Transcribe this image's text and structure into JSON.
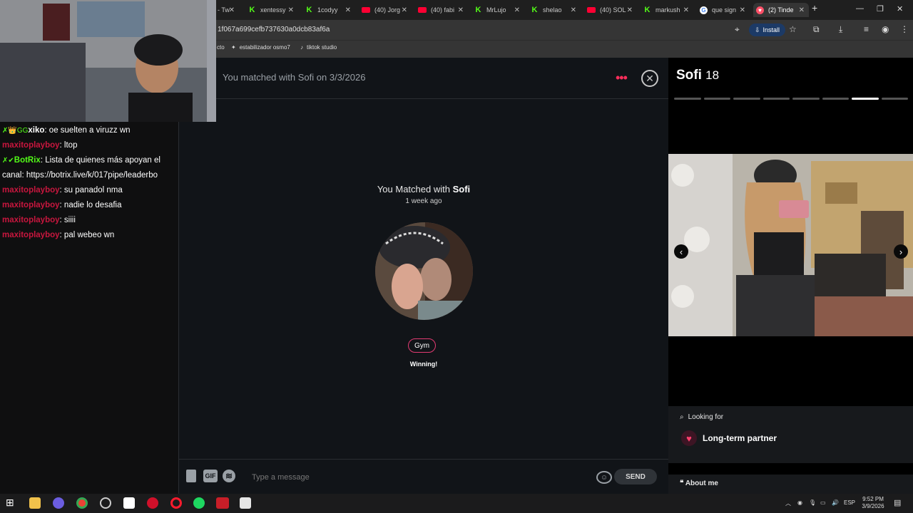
{
  "browser": {
    "tabs": [
      {
        "label": "- Tw",
        "favicon": "tab-fragment"
      },
      {
        "label": "xentessy",
        "favicon": "kick-icon"
      },
      {
        "label": "1codyy",
        "favicon": "kick-icon"
      },
      {
        "label": "(40) Jorg",
        "favicon": "youtube-icon"
      },
      {
        "label": "(40) fabi",
        "favicon": "youtube-icon"
      },
      {
        "label": "MrLujo",
        "favicon": "kick-icon"
      },
      {
        "label": "shelao",
        "favicon": "kick-icon"
      },
      {
        "label": "(40) SOL",
        "favicon": "youtube-icon"
      },
      {
        "label": "markush",
        "favicon": "kick-icon"
      },
      {
        "label": "que sign",
        "favicon": "google-icon"
      },
      {
        "label": "(2) Tinde",
        "favicon": "tinder-icon",
        "active": true
      }
    ],
    "url": "1f067a699cefb737630a0dcb83af6a",
    "install_label": "Install",
    "bookmarks": [
      "cto",
      "estabilizador osmo7",
      "tiktok studio"
    ]
  },
  "chat": {
    "header_title": "You matched with Sofi on 3/3/2026",
    "match_prefix": "You Matched with",
    "match_name": "Sofi",
    "match_time": "1 week ago",
    "chip_label": "Gym",
    "chip_sub": "Winning!",
    "gif_label": "GIF",
    "input_placeholder": "Type a message",
    "send_label": "SEND"
  },
  "profile": {
    "name": "Sofi",
    "age": "18",
    "photo_count": 8,
    "active_photo_index": 6,
    "looking_for_label": "Looking for",
    "looking_for_value": "Long-term partner",
    "about_label": "About me"
  },
  "stream_chat": [
    {
      "badges": "✗👑GG",
      "user": "xiko",
      "user_color": "#ffffff",
      "message": "oe suelten a viruzz wn"
    },
    {
      "badges": "",
      "user": "maxitoplayboy",
      "user_color": "#c8163e",
      "message": "ltop"
    },
    {
      "badges": "✗✔",
      "user": "BotRix",
      "user_color": "#53fc18",
      "message": "Lista de quienes más apoyan el canal: https://botrix.live/k/017pipe/leaderbo"
    },
    {
      "badges": "",
      "user": "maxitoplayboy",
      "user_color": "#c8163e",
      "message": "su panadol nma"
    },
    {
      "badges": "",
      "user": "maxitoplayboy",
      "user_color": "#c8163e",
      "message": "nadie lo desafia"
    },
    {
      "badges": "",
      "user": "maxitoplayboy",
      "user_color": "#c8163e",
      "message": "siiii"
    },
    {
      "badges": "",
      "user": "maxitoplayboy",
      "user_color": "#c8163e",
      "message": "pal webeo wn"
    }
  ],
  "taskbar": {
    "lang": "ESP",
    "time": "9:52 PM",
    "date": "3/9/2026"
  },
  "colors": {
    "tinder_accent": "#fd2e5b",
    "chip_border": "#e33b72",
    "kick_green": "#53fc18"
  }
}
